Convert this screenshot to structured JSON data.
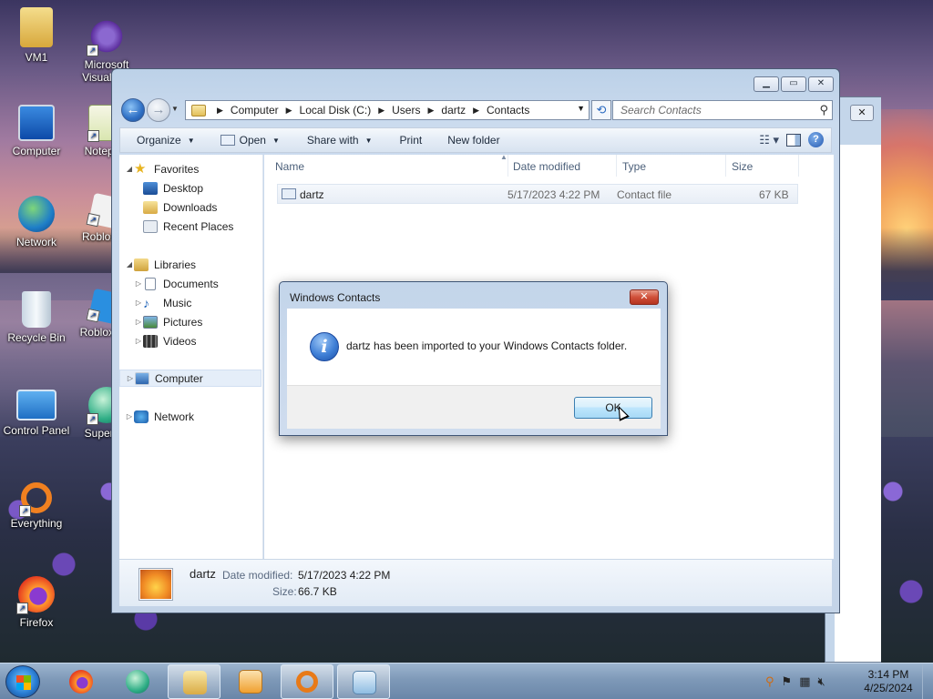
{
  "desktop": {
    "icons": [
      {
        "label": "VM1",
        "icon": "folder-user-icon"
      },
      {
        "label": "Microsoft Visual S...",
        "icon": "visual-studio-icon"
      },
      {
        "label": "Computer",
        "icon": "computer-icon"
      },
      {
        "label": "Notepa...",
        "icon": "notepad-icon"
      },
      {
        "label": "Network",
        "icon": "network-icon"
      },
      {
        "label": "Roblox I...",
        "icon": "roblox-icon"
      },
      {
        "label": "Recycle Bin",
        "icon": "recycle-bin-icon"
      },
      {
        "label": "Roblox S...",
        "icon": "roblox-studio-icon"
      },
      {
        "label": "Control Panel",
        "icon": "control-panel-icon"
      },
      {
        "label": "Supern...",
        "icon": "supernova-icon"
      },
      {
        "label": "Everything",
        "icon": "everything-icon"
      },
      {
        "label": "Firefox",
        "icon": "firefox-icon"
      }
    ]
  },
  "explorer": {
    "breadcrumb": [
      "Computer",
      "Local Disk (C:)",
      "Users",
      "dartz",
      "Contacts"
    ],
    "search_placeholder": "Search Contacts",
    "toolbar": {
      "organize": "Organize",
      "open": "Open",
      "share_with": "Share with",
      "print": "Print",
      "new_folder": "New folder"
    },
    "nav": {
      "favorites": "Favorites",
      "desktop": "Desktop",
      "downloads": "Downloads",
      "recent_places": "Recent Places",
      "libraries": "Libraries",
      "documents": "Documents",
      "music": "Music",
      "pictures": "Pictures",
      "videos": "Videos",
      "computer": "Computer",
      "network": "Network"
    },
    "columns": {
      "name": "Name",
      "date_modified": "Date modified",
      "type": "Type",
      "size": "Size"
    },
    "files": [
      {
        "name": "dartz",
        "date_modified": "5/17/2023 4:22 PM",
        "type": "Contact file",
        "size": "67 KB"
      }
    ],
    "details": {
      "name": "dartz",
      "date_label": "Date modified:",
      "date_value": "5/17/2023 4:22 PM",
      "size_label": "Size:",
      "size_value": "66.7 KB"
    }
  },
  "dialog": {
    "title": "Windows Contacts",
    "message": "dartz has been imported to your Windows Contacts folder.",
    "ok_label": "OK"
  },
  "taskbar": {
    "time": "3:14 PM",
    "date": "4/25/2024"
  }
}
